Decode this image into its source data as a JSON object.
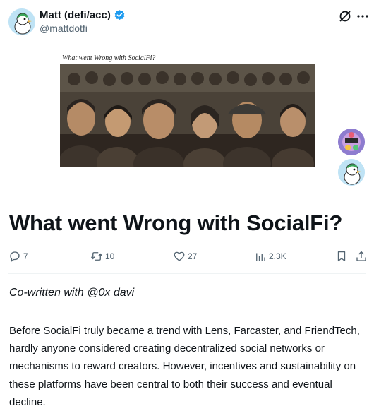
{
  "author": {
    "name": "Matt (defi/acc)",
    "handle": "@mattdotfi",
    "avatar_icon": "bird-avatar",
    "verified_color": "#1d9bf0"
  },
  "header_icons": [
    "grok-icon",
    "more-icon"
  ],
  "cover": {
    "caption": "What went Wrong with SocialFi?",
    "image_desc_icon": "crowd-illustration"
  },
  "article": {
    "title": "What went Wrong with SocialFi?",
    "coauthor_prefix": "Co-written with ",
    "coauthor_handle": "@0x davi",
    "body": "Before SocialFi truly became a trend with Lens, Farcaster, and FriendTech, hardly anyone considered creating decentralized social networks or mechanisms to reward creators. However, incentives and sustainability on these platforms have been central to both their success and eventual decline."
  },
  "stats": {
    "replies": "7",
    "reposts": "10",
    "likes": "27",
    "views": "2.3K"
  },
  "colors": {
    "text": "#0f1419",
    "muted": "#536471",
    "accent": "#1d9bf0"
  }
}
